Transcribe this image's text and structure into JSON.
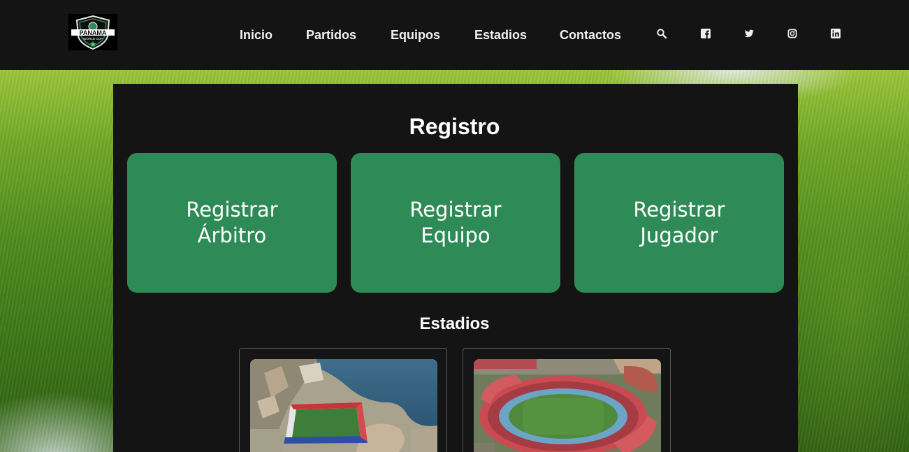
{
  "header": {
    "logo_alt": "PANAMA WORLD CUP",
    "nav": [
      "Inicio",
      "Partidos",
      "Equipos",
      "Estadios",
      "Contactos"
    ],
    "icons": [
      "search-icon",
      "facebook-icon",
      "twitter-icon",
      "instagram-icon",
      "linkedin-icon"
    ]
  },
  "main": {
    "title": "Registro",
    "buttons": [
      {
        "line1": "Registrar",
        "line2": "Árbitro"
      },
      {
        "line1": "Registrar",
        "line2": "Equipo"
      },
      {
        "line1": "Registrar",
        "line2": "Jugador"
      }
    ],
    "stadiums_title": "Estadios"
  },
  "colors": {
    "header_bg": "#141414",
    "card_bg": "#141414",
    "button_green": "#2e8b57",
    "text": "#ffffff"
  }
}
